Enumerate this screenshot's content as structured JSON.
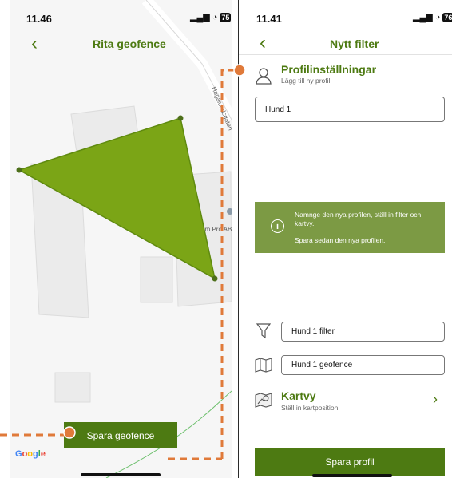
{
  "left": {
    "status": {
      "time": "11.46",
      "battery": "75"
    },
    "title": "Rita geofence",
    "map_labels": {
      "street": "Hagalundsgatan",
      "poi": "Mobilcom Pro AB"
    },
    "save_button": "Spara geofence",
    "google": "Google"
  },
  "right": {
    "status": {
      "time": "11.41",
      "battery": "76"
    },
    "title": "Nytt filter",
    "profile": {
      "title": "Profilinställningar",
      "subtitle": "Lägg till ny profil"
    },
    "name_field": "Hund 1",
    "info": {
      "line1": "Namnge den nya profilen, ställ in filter och kartvy.",
      "line2": "Spara sedan den nya profilen."
    },
    "filter_field": "Hund 1 filter",
    "geofence_field": "Hund 1 geofence",
    "mapview": {
      "title": "Kartvy",
      "subtitle": "Ställ in kartposition"
    },
    "save_button": "Spara profil"
  },
  "colors": {
    "brand_green": "#4d7a12",
    "geofence_fill": "#7ba516",
    "info_bg": "#7c9a44",
    "annotation": "#e07a3a"
  }
}
